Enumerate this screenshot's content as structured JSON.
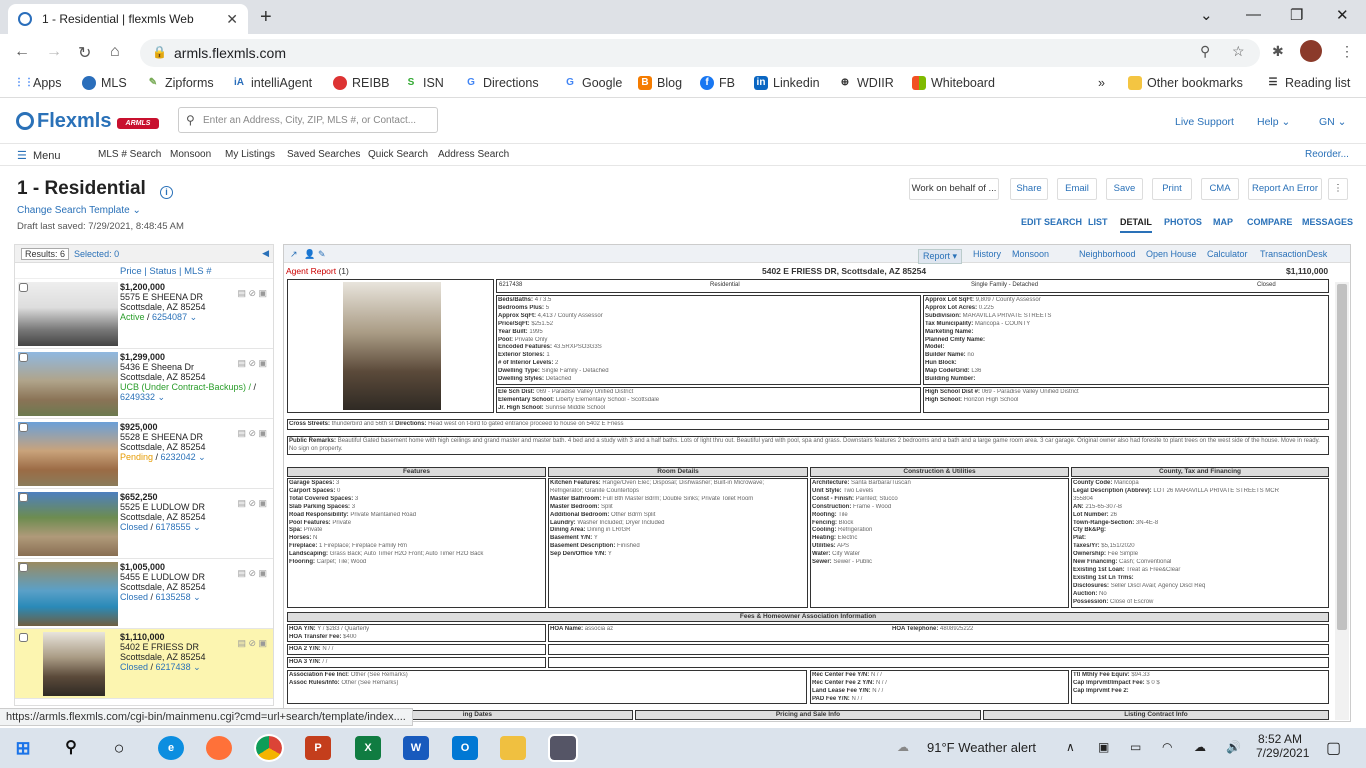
{
  "browser": {
    "tab_title": "1 - Residential | flexmls Web",
    "tab_close": "✕",
    "new_tab": "+",
    "url": "armls.flexmls.com",
    "status_url": "https://armls.flexmls.com/cgi-bin/mainmenu.cgi?cmd=url+search/template/index....",
    "bookmarks": [
      "Apps",
      "MLS",
      "Zipforms",
      "intelliAgent",
      "REIBB",
      "ISN",
      "Directions",
      "Google",
      "Blog",
      "FB",
      "Linkedin",
      "WDIIR",
      "Whiteboard"
    ],
    "bookmarks_more": "»",
    "other_bookmarks": "Other bookmarks",
    "reading_list": "Reading list"
  },
  "header": {
    "logo": "Flexmls",
    "armls_badge": "ARMLS",
    "search_placeholder": "Enter an Address, City, ZIP, MLS #, or Contact...",
    "live_support": "Live Support",
    "help": "Help ⌄",
    "user": "GN ⌄"
  },
  "menu": {
    "label": "Menu",
    "items": [
      "MLS # Search",
      "Monsoon",
      "My Listings",
      "Saved Searches",
      "Quick Search",
      "Address Search"
    ],
    "reorder": "Reorder..."
  },
  "page": {
    "title": "1 - Residential",
    "change_template": "Change Search Template ⌄",
    "draft": "Draft last saved: 7/29/2021, 8:48:45 AM",
    "actions": [
      "Work on behalf of ...",
      "Share",
      "Email",
      "Save",
      "Print",
      "CMA",
      "Report An Error"
    ],
    "views": [
      "EDIT SEARCH",
      "LIST",
      "DETAIL",
      "PHOTOS",
      "MAP",
      "COMPARE",
      "MESSAGES"
    ],
    "active_view": "DETAIL"
  },
  "results": {
    "count_label": "Results: 6",
    "selected_label": "Selected: 0",
    "sort_links": "Price | Status | MLS #",
    "items": [
      {
        "price": "$1,200,000",
        "addr1": "5575 E SHEENA DR",
        "addr2": "Scottsdale, AZ 85254",
        "status": "Active",
        "mls": "6254087",
        "cls": "act"
      },
      {
        "price": "$1,299,000",
        "addr1": "5436 E Sheena Dr",
        "addr2": "Scottsdale, AZ 85254",
        "status": "UCB (Under Contract-Backups) /",
        "mls": "6249332",
        "cls": "ucb"
      },
      {
        "price": "$925,000",
        "addr1": "5528 E SHEENA DR",
        "addr2": "Scottsdale, AZ 85254",
        "status": "Pending",
        "mls": "6232042",
        "cls": "pend"
      },
      {
        "price": "$652,250",
        "addr1": "5525 E LUDLOW DR",
        "addr2": "Scottsdale, AZ 85254",
        "status": "Closed",
        "mls": "6178555",
        "cls": "closed"
      },
      {
        "price": "$1,005,000",
        "addr1": "5455 E LUDLOW DR",
        "addr2": "Scottsdale, AZ 85254",
        "status": "Closed",
        "mls": "6135258",
        "cls": "closed"
      },
      {
        "price": "$1,110,000",
        "addr1": "5402 E FRIESS DR",
        "addr2": "Scottsdale, AZ 85254",
        "status": "Closed",
        "mls": "6217438",
        "cls": "closed"
      }
    ]
  },
  "detail_toolbar": [
    "Report ▾",
    "History",
    "Monsoon",
    "Neighborhood",
    "Open House",
    "Calculator",
    "TransactionDesk"
  ],
  "report": {
    "agent_report": "Agent Report",
    "agent_report_count": "(1)",
    "address": "5402 E FRIESS DR, Scottsdale, AZ 85254",
    "price": "$1,110,000",
    "mls": "6217438",
    "class": "Residential",
    "type": "Single Family - Detached",
    "status": "Closed",
    "left_details": [
      [
        "Beds/Baths:",
        "4 / 3.5"
      ],
      [
        "Bedrooms Plus:",
        "5"
      ],
      [
        "Approx SqFt:",
        "4,413 / County Assessor"
      ],
      [
        "Price/SqFt:",
        "$251.52"
      ],
      [
        "Year Built:",
        "1995"
      ],
      [
        "Pool:",
        "Private Only"
      ],
      [
        "Encoded Features:",
        "43.5RXPSO3G3S"
      ],
      [
        "Exterior Stories:",
        "1"
      ],
      [
        "# of Interior Levels:",
        "2"
      ],
      [
        "Dwelling Type:",
        "Single Family - Detached"
      ],
      [
        "Dwelling Styles:",
        "Detached"
      ]
    ],
    "right_details": [
      [
        "Approx Lot SqFt:",
        "9,809 / County Assessor"
      ],
      [
        "Approx Lot Acres:",
        "0.225"
      ],
      [
        "Subdivision:",
        "MARAVILLA PRIVATE STREETS"
      ],
      [
        "Tax Municipality:",
        "Maricopa - COUNTY"
      ],
      [
        "Marketing Name:",
        ""
      ],
      [
        "Planned Cmty Name:",
        ""
      ],
      [
        "Model:",
        ""
      ],
      [
        "Builder Name:",
        "no"
      ],
      [
        "Hun Block:",
        ""
      ],
      [
        "Map Code/Grid:",
        "L36"
      ],
      [
        "Building Number:",
        ""
      ]
    ],
    "schools_left": [
      [
        "Ele Sch Dist:",
        "069 - Paradise Valley Unified District"
      ],
      [
        "Elementary School:",
        "Liberty Elementary School - Scottsdale"
      ],
      [
        "Jr. High School:",
        "Sunrise Middle School"
      ]
    ],
    "schools_right": [
      [
        "High School Dist #:",
        "069 - Paradise Valley Unified District"
      ],
      [
        "High School:",
        "Horizon High School"
      ]
    ],
    "cross_label": "Cross Streets:",
    "cross": "thunderbird and 56th st",
    "directions_label": "Directions:",
    "directions": "Head west on t-bird to gated entrance proceed to house on 5402 E Friess",
    "remarks_label": "Public Remarks:",
    "remarks": "Beautiful Gated basement home with high ceilings and grand master and master bath. 4 bed and a study with 3 and a half baths. Lots of light thru out. Beautiful yard with pool, spa and grass. Downstairs features 2 bedrooms and a bath and a large game room area. 3 car garage. Original owner also had foresite to plant trees on the west side of the house. Move in ready. No sign on property.",
    "sections": [
      "Features",
      "Room Details",
      "Construction & Utilities",
      "County, Tax and Financing"
    ],
    "features": [
      [
        "Garage Spaces:",
        "3"
      ],
      [
        "Carport Spaces:",
        "0"
      ],
      [
        "Total Covered Spaces:",
        "3"
      ],
      [
        "Slab Parking Spaces:",
        "3"
      ],
      [
        "Road Responsibility:",
        "Private Maintained Road"
      ],
      [
        "Pool Features:",
        "Private"
      ],
      [
        "Spa:",
        "Private"
      ],
      [
        "Horses:",
        "N"
      ],
      [
        "Fireplace:",
        "1 Fireplace; Fireplace Family Rm"
      ],
      [
        "Landscaping:",
        "Grass Back; Auto Timer H2O Front; Auto Timer H2O Back"
      ],
      [
        "Flooring:",
        "Carpet; Tile; Wood"
      ]
    ],
    "rooms": [
      [
        "Kitchen Features:",
        "Range/Oven Elec; Disposal; Dishwasher; Built-in Microwave;"
      ],
      [
        "",
        "Refrigerator; Granite Countertops"
      ],
      [
        "Master Bathroom:",
        "Full Bth Master Bdrm; Double Sinks; Private Toilet Room"
      ],
      [
        "Master Bedroom:",
        "Split"
      ],
      [
        "Additional Bedroom:",
        "Other Bdrm Split"
      ],
      [
        "Laundry:",
        "Washer Included; Dryer Included"
      ],
      [
        "Dining Area:",
        "Dining in LR/GR"
      ],
      [
        "Basement Y/N:",
        "Y"
      ],
      [
        "Basement Description:",
        "Finished"
      ],
      [
        "Sep Den/Office Y/N:",
        "Y"
      ]
    ],
    "construction": [
      [
        "Architecture:",
        "Santa Barbara/Tuscan"
      ],
      [
        "Unit Style:",
        "Two Levels"
      ],
      [
        "Const - Finish:",
        "Painted; Stucco"
      ],
      [
        "Construction:",
        "Frame - Wood"
      ],
      [
        "Roofing:",
        "Tile"
      ],
      [
        "Fencing:",
        "Block"
      ],
      [
        "Cooling:",
        "Refrigeration"
      ],
      [
        "Heating:",
        "Electric"
      ],
      [
        "Utilities:",
        "APS"
      ],
      [
        "Water:",
        "City Water"
      ],
      [
        "Sewer:",
        "Sewer - Public"
      ]
    ],
    "county": [
      [
        "County Code:",
        "Maricopa"
      ],
      [
        "Legal Description (Abbrev):",
        "LOT 26 MARAVILLA PRIVATE STREETS MCR"
      ],
      [
        "",
        "355804"
      ],
      [
        "AN:",
        "215-65-307-B"
      ],
      [
        "Lot Number:",
        "26"
      ],
      [
        "Town-Range-Section:",
        "3N-4E-8"
      ],
      [
        "Cty Bk&Pg:",
        ""
      ],
      [
        "Plat:",
        ""
      ],
      [
        "Taxes/Yr:",
        "$5,151/2020"
      ],
      [
        "Ownership:",
        "Fee Simple"
      ],
      [
        "New Financing:",
        "Cash; Conventional"
      ],
      [
        "Existing 1st Loan:",
        "Treat as Free&Clear"
      ],
      [
        "Existing 1st Ln Trms:",
        ""
      ],
      [
        "Disclosures:",
        "Seller Discl Avail; Agency Discl Req"
      ],
      [
        "Auction:",
        "No"
      ],
      [
        "Possession:",
        "Close of Escrow"
      ]
    ],
    "hoa_head": "Fees & Homeowner Association Information",
    "hoa_left": [
      [
        "HOA Y/N:",
        "Y / $283 / Quarterly"
      ],
      [
        "HOA Transfer Fee:",
        "$400"
      ]
    ],
    "hoa_name": [
      "HOA Name:",
      "associa az"
    ],
    "hoa_tel": [
      "HOA Telephone:",
      "4808925222"
    ],
    "hoa2": [
      "HOA 2 Y/N:",
      "N / /"
    ],
    "hoa3": [
      "HOA 3 Y/N:",
      "/ /"
    ],
    "assoc": [
      [
        "Association Fee Incl:",
        "Other (See Remarks)"
      ],
      [
        "Assoc Rules/Info:",
        "Other (See Remarks)"
      ]
    ],
    "rec": [
      [
        "Rec Center Fee Y/N:",
        "N / /"
      ],
      [
        "Rec Center Fee 2 Y/N:",
        "N / /"
      ],
      [
        "Land Lease Fee Y/N:",
        "N / /"
      ],
      [
        "PAD Fee Y/N:",
        "N / /"
      ]
    ],
    "ttl": [
      [
        "Ttl Mthly Fee Equiv:",
        "$94.33"
      ],
      [
        "Cap Imprvmt/Impact Fee:",
        "$ 0 $"
      ],
      [
        "Cap Imprvmt Fee 2:",
        ""
      ]
    ],
    "bottom_sections": [
      "ing Dates",
      "Pricing and Sale Info",
      "Listing Contract Info"
    ]
  },
  "taskbar": {
    "weather": "91°F  Weather alert",
    "time": "8:52 AM",
    "date": "7/29/2021"
  }
}
